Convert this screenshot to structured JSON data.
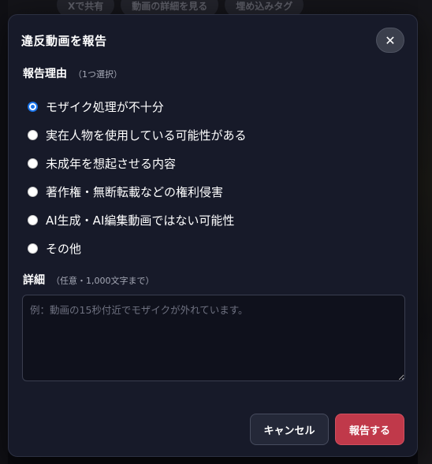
{
  "background": {
    "chips": [
      "Xで共有",
      "動画の詳細を見る",
      "埋め込みタグ"
    ]
  },
  "dialog": {
    "title": "違反動画を報告",
    "close_icon": "close-icon",
    "reason": {
      "label": "報告理由",
      "hint": "（1つ選択）",
      "selected": "モザイク処理が不十分",
      "options": [
        "モザイク処理が不十分",
        "実在人物を使用している可能性がある",
        "未成年を想起させる内容",
        "著作権・無断転載などの権利侵害",
        "AI生成・AI編集動画ではない可能性",
        "その他"
      ]
    },
    "detail": {
      "label": "詳細",
      "hint": "（任意・1,000文字まで）",
      "placeholder": "例：動画の15秒付近でモザイクが外れています。",
      "value": ""
    },
    "buttons": {
      "cancel": "キャンセル",
      "submit": "報告する"
    },
    "colors": {
      "panel": "#171a29",
      "submit": "#c0394a",
      "radio_checked": "#1a73e8"
    }
  }
}
